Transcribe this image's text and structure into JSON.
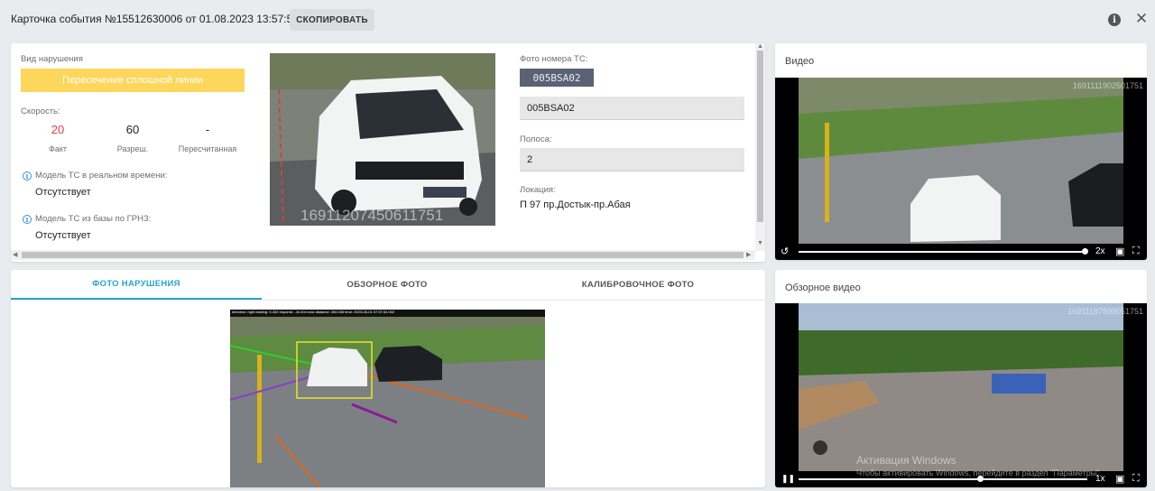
{
  "header": {
    "title": "Карточка события №15512630006 от 01.08.2023 13:57:54",
    "copy_label": "СКОПИРОВАТЬ",
    "info_icon": "i",
    "close_icon": "✕"
  },
  "event": {
    "violation_type_label": "Вид нарушения",
    "violation_type_value": "Пересечение сплошной линии",
    "speed_label": "Скорость:",
    "speed": {
      "actual": "20",
      "actual_label": "Факт",
      "allowed": "60",
      "allowed_label": "Разреш.",
      "recalc": "-",
      "recalc_label": "Пересчитанная"
    },
    "model_realtime_label": "Модель ТС в реальном времени:",
    "model_realtime_value": "Отсутствует",
    "model_db_label": "Модель ТС из базы по ГРНЗ:",
    "model_db_value": "Отсутствует",
    "photo_watermark": "1691120745061175​1",
    "plate_photo_label": "Фото номера ТС:",
    "plate_photo_text": "005BSA02",
    "plate_value": "005BSA02",
    "lane_label": "Полоса:",
    "lane_value": "2",
    "location_label": "Локация:",
    "location_value": "П 97 пр.Достык-пр.Абая"
  },
  "video": {
    "title": "Видео",
    "id": "1691111902501751",
    "speed": "2x"
  },
  "overview_video": {
    "title": "Обзорное видео",
    "id": "16911197599051751",
    "speed": "1x",
    "windows_watermark_1": "Активация Windows",
    "windows_watermark_2": "Чтобы активировать Windows, перейдите в раздел \"Параметры\"."
  },
  "tabs": [
    {
      "label": "ФОТО НАРУШЕНИЯ",
      "active": true
    },
    {
      "label": "ОБЗОРНОЕ ФОТО",
      "active": false
    },
    {
      "label": "КАЛИБРОВОЧНОЕ ФОТО",
      "active": false
    }
  ],
  "violation_photo_caption": "direction: right  easting: 5.402  required: -44.404  max distance: 284.036  time: 2023-08-01 07:57:54.002",
  "colors": {
    "accent": "#2aa3c8",
    "badge": "#fdd65c",
    "speed_actual": "#e03d4c"
  },
  "icons": [
    "info-icon",
    "close-icon",
    "replay-icon",
    "pause-icon",
    "pip-icon",
    "fullscreen-icon"
  ]
}
